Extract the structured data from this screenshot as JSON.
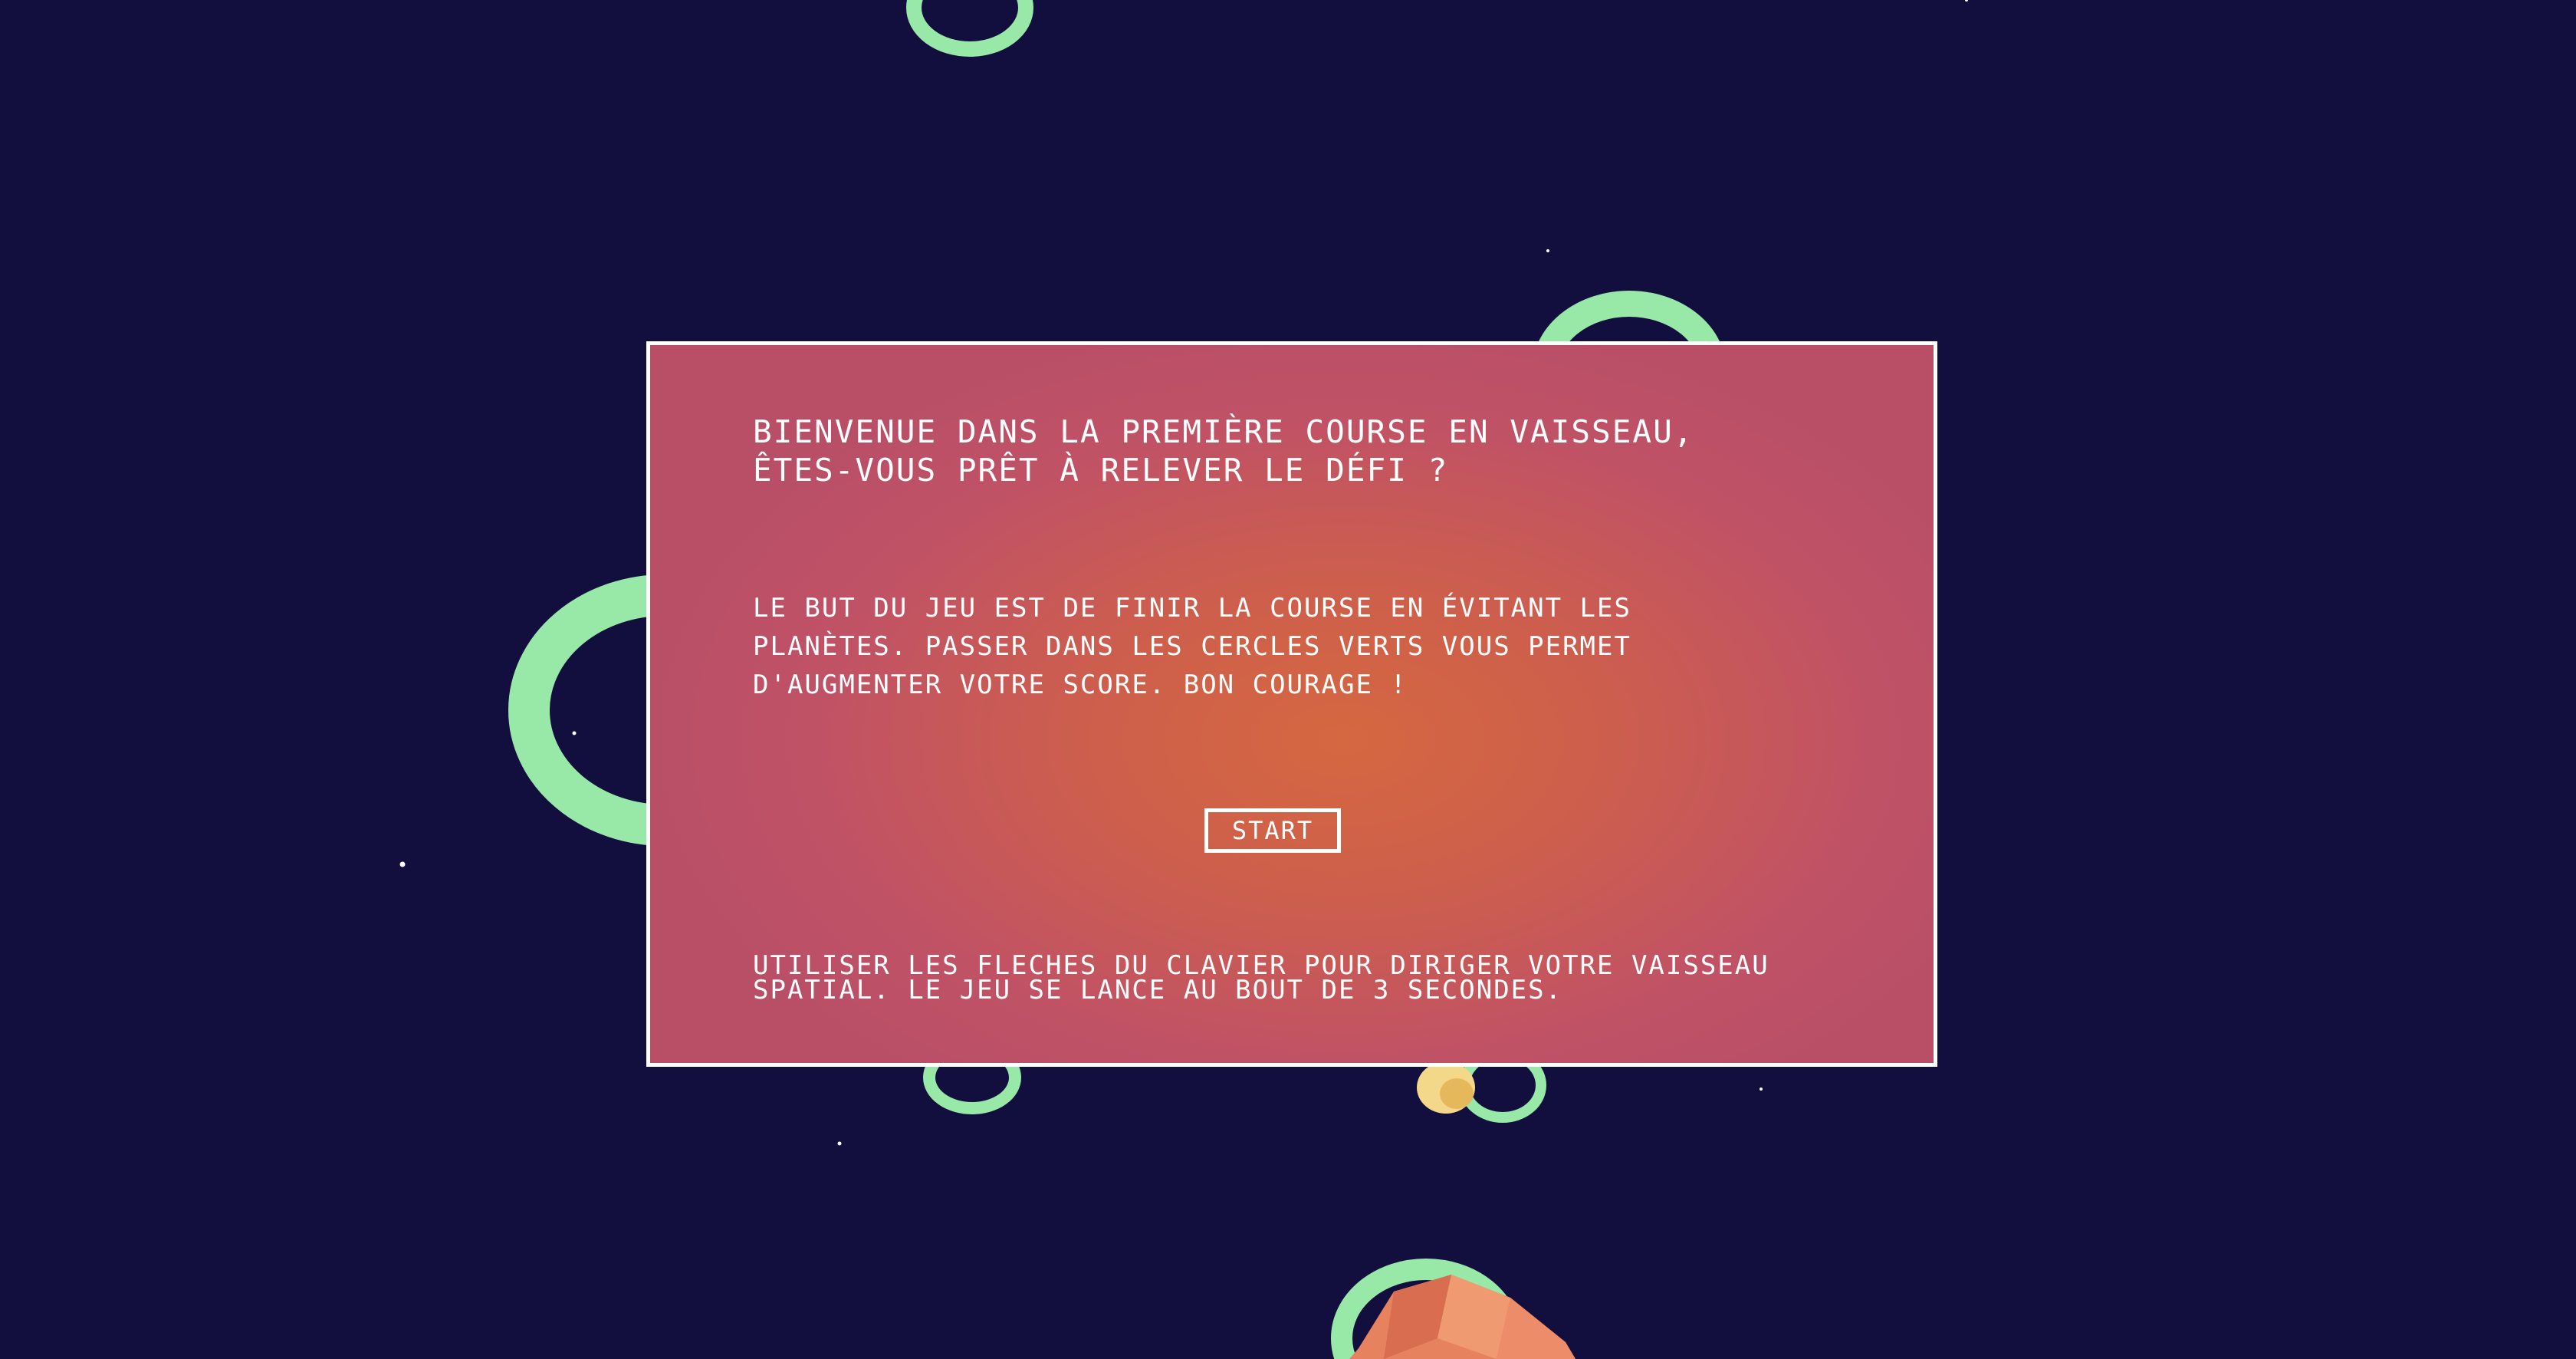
{
  "game": {
    "background_color": "#120f3f",
    "ring_color": "#98e8a8",
    "planet_color": "#e7825f",
    "star_color": "#ffffff"
  },
  "intro_modal": {
    "title": "BIENVENUE DANS LA PREMIÈRE COURSE EN VAISSEAU,\nÊTES-VOUS PRÊT À RELEVER LE DÉFI ?",
    "description": "LE BUT DU JEU EST DE FINIR LA COURSE EN ÉVITANT LES\nPLANÈTES. PASSER DANS LES CERCLES VERTS VOUS PERMET\nD'AUGMENTER VOTRE SCORE. BON COURAGE !",
    "start_label": "START",
    "instructions": "UTILISER LES FLECHES DU CLAVIER POUR DIRIGER VOTRE VAISSEAU\nSPATIAL. LE JEU SE LANCE AU BOUT DE 3 SECONDES.",
    "background_colors": [
      "#b84f67",
      "#d66840"
    ],
    "border_color": "#ffffff"
  }
}
